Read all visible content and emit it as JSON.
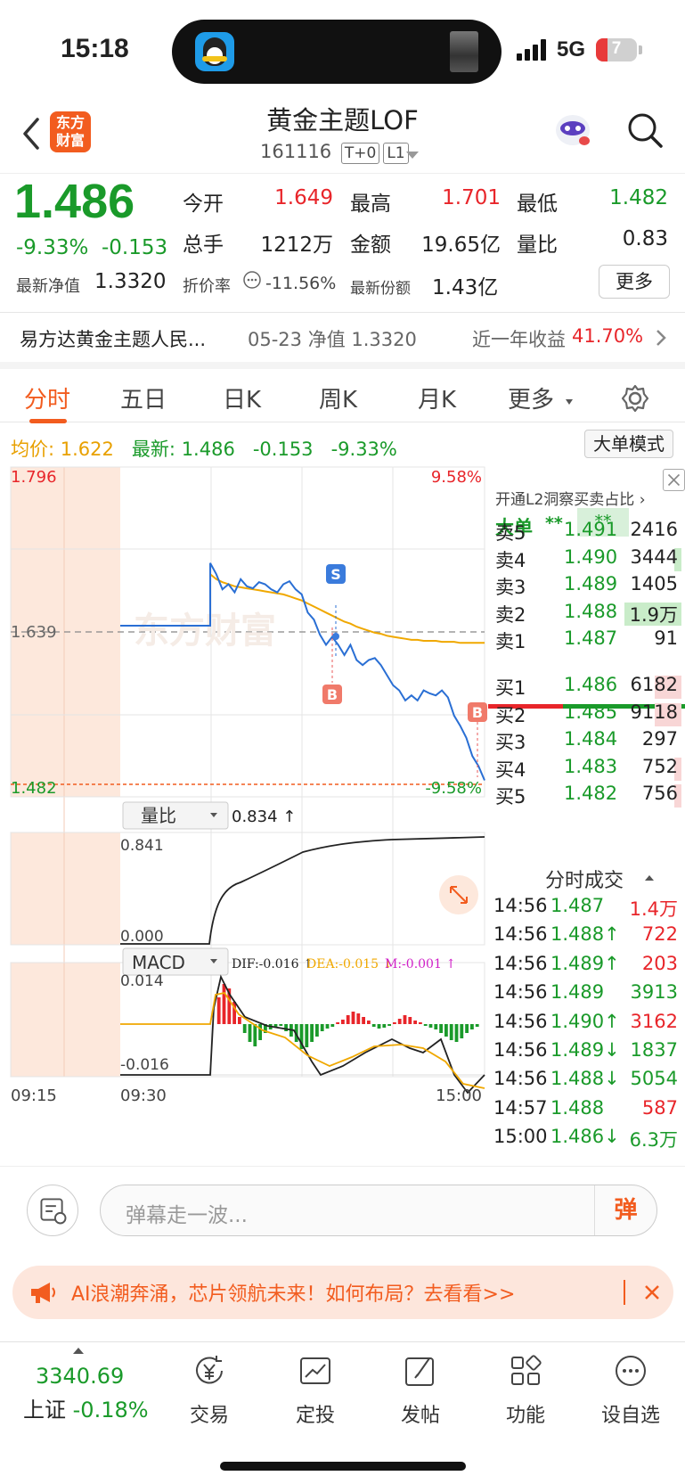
{
  "status_bar": {
    "time": "15:18",
    "network": "5G",
    "battery": "7"
  },
  "header": {
    "title": "黄金主题LOF",
    "code": "161116",
    "tags": [
      "T+0",
      "L1"
    ],
    "logo_text_1": "东方",
    "logo_text_2": "财富"
  },
  "quote": {
    "price": "1.486",
    "change_pct": "-9.33%",
    "change": "-0.153",
    "open_label": "今开",
    "open": "1.649",
    "high_label": "最高",
    "high": "1.701",
    "low_label": "最低",
    "low": "1.482",
    "volume_label": "总手",
    "volume": "1212万",
    "amount_label": "金额",
    "amount": "19.65亿",
    "ratio_label": "量比",
    "ratio": "0.83",
    "nav_label": "最新净值",
    "nav": "1.3320",
    "discount_label": "折价率",
    "discount": "-11.56%",
    "shares_label": "最新份额",
    "shares": "1.43亿",
    "more_label": "更多"
  },
  "fund_row": {
    "name": "易方达黄金主题人民...",
    "nav_date": "05-23 净值 1.3320",
    "year_label": "近一年收益",
    "year_value": "41.70%"
  },
  "tabs": [
    "分时",
    "五日",
    "日K",
    "周K",
    "月K",
    "更多"
  ],
  "info_bar": {
    "avg_label": "均价:",
    "avg": "1.622",
    "latest_label": "最新:",
    "latest": "1.486",
    "latest_change": "-0.153",
    "latest_pct": "-9.33%",
    "big_order_mode": "大单模式"
  },
  "chart_labels": {
    "top_price": "1.796",
    "top_pct": "9.58%",
    "mid_price": "1.639",
    "bottom_price": "1.482",
    "bottom_pct": "-9.58%",
    "watermark": "东方财富",
    "vol_selector": "量比",
    "vol_value": "0.834 ↑",
    "vol_max": "0.841",
    "vol_min": "0.000",
    "macd_selector": "MACD",
    "dif": "DIF:-0.016 ↑",
    "dea": "DEA:-0.015 ↓",
    "m": "M:-0.001 ↑",
    "macd_max": "0.014",
    "macd_min": "-0.016",
    "t_start": "09:15",
    "t_open": "09:30",
    "t_end": "15:00",
    "s_marker": "S",
    "b_marker": "B"
  },
  "chart_data": {
    "type": "line",
    "x_range": [
      "09:15",
      "15:00"
    ],
    "ylim": [
      1.482,
      1.796
    ],
    "reference": 1.639,
    "series": [
      {
        "name": "最新",
        "color": "#2a6fd4",
        "values": [
          1.639,
          1.639,
          1.639,
          1.639,
          1.639,
          1.701,
          1.69,
          1.675,
          1.68,
          1.672,
          1.685,
          1.678,
          1.676,
          1.682,
          1.68,
          1.675,
          1.672,
          1.68,
          1.683,
          1.675,
          1.67,
          1.652,
          1.645,
          1.63,
          1.62,
          1.628,
          1.62,
          1.61,
          1.62,
          1.605,
          1.6,
          1.605,
          1.607,
          1.6,
          1.59,
          1.58,
          1.575,
          1.565,
          1.57,
          1.565,
          1.575,
          1.572,
          1.57,
          1.575,
          1.568,
          1.55,
          1.54,
          1.528,
          1.51,
          1.5,
          1.486
        ]
      },
      {
        "name": "均价",
        "color": "#f0a800",
        "values": [
          1.639,
          1.639,
          1.639,
          1.639,
          1.639,
          1.69,
          1.685,
          1.682,
          1.68,
          1.678,
          1.677,
          1.676,
          1.675,
          1.674,
          1.673,
          1.672,
          1.671,
          1.67,
          1.668,
          1.666,
          1.664,
          1.661,
          1.658,
          1.655,
          1.652,
          1.649,
          1.646,
          1.643,
          1.641,
          1.638,
          1.636,
          1.634,
          1.632,
          1.631,
          1.629,
          1.628,
          1.627,
          1.626,
          1.625,
          1.625,
          1.624,
          1.624,
          1.624,
          1.623,
          1.623,
          1.623,
          1.622,
          1.622,
          1.622,
          1.622,
          1.622
        ]
      }
    ]
  },
  "side_panel": {
    "l2_text": "开通L2洞察买卖占比 ›",
    "big_label": "大单",
    "stars_1": "**",
    "stars_2": "**",
    "sells": [
      {
        "label": "卖5",
        "price": "1.491",
        "vol": "2416"
      },
      {
        "label": "卖4",
        "price": "1.490",
        "vol": "3444"
      },
      {
        "label": "卖3",
        "price": "1.489",
        "vol": "1405"
      },
      {
        "label": "卖2",
        "price": "1.488",
        "vol": "1.9万"
      },
      {
        "label": "卖1",
        "price": "1.487",
        "vol": "91"
      }
    ],
    "buys": [
      {
        "label": "买1",
        "price": "1.486",
        "vol": "6182"
      },
      {
        "label": "买2",
        "price": "1.485",
        "vol": "9118"
      },
      {
        "label": "买3",
        "price": "1.484",
        "vol": "297"
      },
      {
        "label": "买4",
        "price": "1.483",
        "vol": "752"
      },
      {
        "label": "买5",
        "price": "1.482",
        "vol": "756"
      }
    ],
    "ticks_title": "分时成交",
    "ticks": [
      {
        "t": "14:56",
        "p": "1.487",
        "v": "1.4万",
        "pc": "green",
        "vc": "red"
      },
      {
        "t": "14:56",
        "p": "1.488↑",
        "v": "722",
        "pc": "green",
        "vc": "red"
      },
      {
        "t": "14:56",
        "p": "1.489↑",
        "v": "203",
        "pc": "green",
        "vc": "red"
      },
      {
        "t": "14:56",
        "p": "1.489",
        "v": "3913",
        "pc": "green",
        "vc": "green"
      },
      {
        "t": "14:56",
        "p": "1.490↑",
        "v": "3162",
        "pc": "green",
        "vc": "red"
      },
      {
        "t": "14:56",
        "p": "1.489↓",
        "v": "1837",
        "pc": "green",
        "vc": "green"
      },
      {
        "t": "14:56",
        "p": "1.488↓",
        "v": "5054",
        "pc": "green",
        "vc": "green"
      },
      {
        "t": "14:57",
        "p": "1.488",
        "v": "587",
        "pc": "green",
        "vc": "red"
      },
      {
        "t": "15:00",
        "p": "1.486↓",
        "v": "6.3万",
        "pc": "green",
        "vc": "green"
      }
    ]
  },
  "danmu": {
    "placeholder": "弹幕走一波...",
    "send": "弹"
  },
  "banner": {
    "text": "AI浪潮奔涌，芯片领航未来！如何布局？去看看>>"
  },
  "bottom_nav": {
    "index_value": "3340.69",
    "index_name": "上证",
    "index_change": "-0.18%",
    "items": [
      "交易",
      "定投",
      "发帖",
      "功能",
      "设自选"
    ]
  },
  "colors": {
    "up": "#e8252a",
    "down": "#1a9a2a",
    "accent": "#f25c1f",
    "price_line": "#2a6fd4",
    "avg_line": "#f0a800"
  }
}
